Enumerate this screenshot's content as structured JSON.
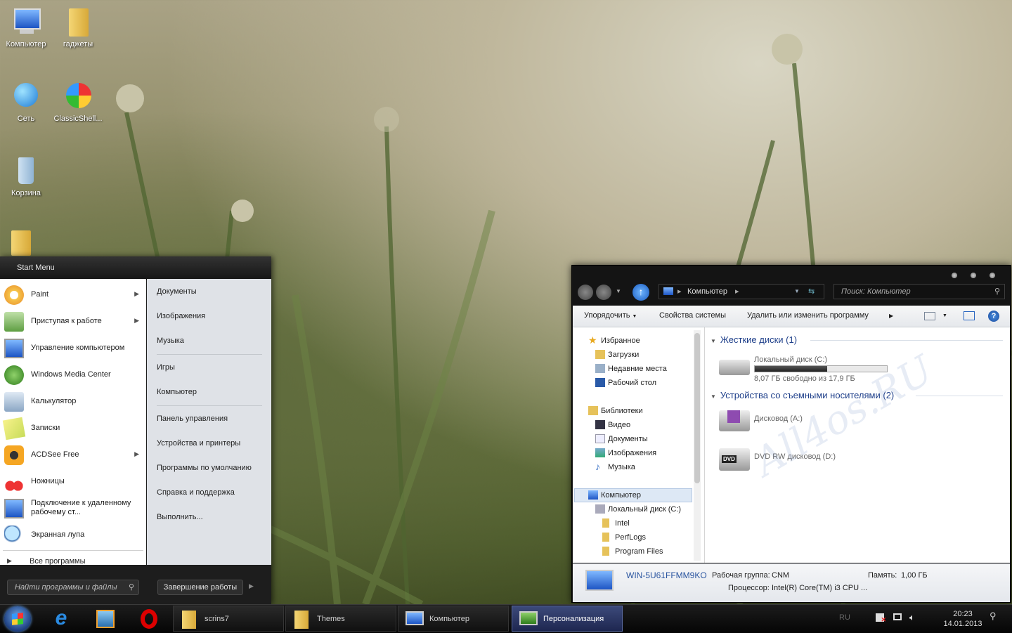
{
  "desktop": {
    "icons": [
      {
        "label": "Компьютер"
      },
      {
        "label": "гаджеты"
      },
      {
        "label": "Сеть"
      },
      {
        "label": "ClassicShell..."
      },
      {
        "label": "Корзина"
      }
    ]
  },
  "start_menu": {
    "header": "Start Menu",
    "programs": [
      {
        "label": "Paint",
        "arrow": "▶"
      },
      {
        "label": "Приступая к работе",
        "arrow": "▶"
      },
      {
        "label": "Управление компьютером"
      },
      {
        "label": "Windows Media Center"
      },
      {
        "label": "Калькулятор"
      },
      {
        "label": "Записки"
      },
      {
        "label": "ACDSee Free",
        "arrow": "▶"
      },
      {
        "label": "Ножницы"
      },
      {
        "label": "Подключение к удаленному рабочему ст..."
      },
      {
        "label": "Экранная лупа"
      }
    ],
    "all_programs": "Все программы",
    "right_items": [
      "Документы",
      "Изображения",
      "Музыка",
      "Игры",
      "Компьютер",
      "Панель управления",
      "Устройства и принтеры",
      "Программы по умолчанию",
      "Справка и поддержка",
      "Выполнить..."
    ],
    "search_placeholder": "Найти программы и файлы",
    "shutdown": "Завершение работы"
  },
  "explorer": {
    "address": "Компьютер",
    "search_placeholder": "Поиск: Компьютер",
    "toolbar": {
      "organize": "Упорядочить",
      "system_props": "Свойства системы",
      "uninstall": "Удалить или изменить программу"
    },
    "nav": {
      "favorites": "Избранное",
      "downloads": "Загрузки",
      "recent": "Недавние места",
      "desktop": "Рабочий стол",
      "libraries": "Библиотеки",
      "video": "Видео",
      "documents": "Документы",
      "images": "Изображения",
      "music": "Музыка",
      "computer": "Компьютер",
      "local_disk": "Локальный диск (C:)",
      "intel": "Intel",
      "perflogs": "PerfLogs",
      "program_files": "Program Files"
    },
    "groups": {
      "hdd": "Жесткие диски (1)",
      "removable": "Устройства со съемными носителями (2)"
    },
    "drives": {
      "c_name": "Локальный диск (C:)",
      "c_free": "8,07 ГБ свободно из 17,9 ГБ",
      "c_used_fraction": 0.55,
      "a_name": "Дисковод (A:)",
      "d_name": "DVD RW дисковод (D:)",
      "dvd_badge": "DVD"
    },
    "status": {
      "computer_name": "WIN-5U61FFMM9KO",
      "workgroup_label": "Рабочая группа:",
      "workgroup": "CNM",
      "memory_label": "Память:",
      "memory": "1,00 ГБ",
      "cpu_label": "Процессор:",
      "cpu": "Intel(R) Core(TM) i3 CPU",
      "cpu_more": "..."
    }
  },
  "watermark": "All4os.RU",
  "taskbar": {
    "windows": [
      "scrins7",
      "Themes",
      "Компьютер",
      "Персонализация"
    ],
    "lang": "RU",
    "time": "20:23",
    "date": "14.01.2013"
  }
}
